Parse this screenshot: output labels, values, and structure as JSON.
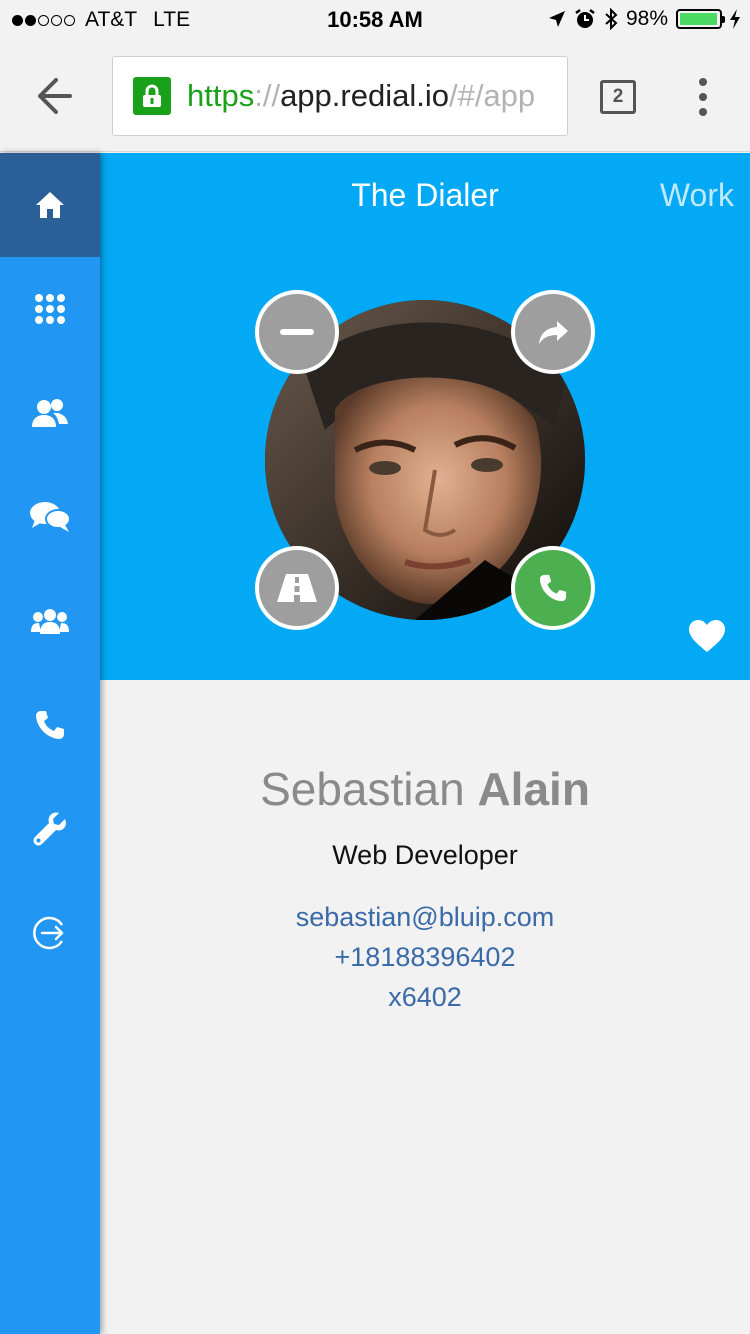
{
  "status_bar": {
    "carrier": "AT&T",
    "network": "LTE",
    "time": "10:58 AM",
    "battery": "98%",
    "battery_level": 0.98
  },
  "browser": {
    "url_protocol": "https",
    "url_sep": "://",
    "url_host": "app.redial.io",
    "url_path": "/#/app",
    "tab_count": "2"
  },
  "sidebar": {
    "items": [
      {
        "icon": "home-icon",
        "active": true
      },
      {
        "icon": "dialpad-icon"
      },
      {
        "icon": "contacts-icon"
      },
      {
        "icon": "chat-icon"
      },
      {
        "icon": "groups-icon"
      },
      {
        "icon": "phone-icon"
      },
      {
        "icon": "wrench-icon"
      },
      {
        "icon": "logout-icon"
      }
    ]
  },
  "header": {
    "title": "The Dialer",
    "tag": "Work"
  },
  "profile": {
    "first_name": "Sebastian",
    "last_name": "Alain",
    "job_title": "Web Developer",
    "email": "sebastian@bluip.com",
    "phone": "+18188396402",
    "extension": "x6402"
  },
  "colors": {
    "header_bg": "#03a9f4",
    "sidebar_bg": "#2196f3",
    "sidebar_active": "#2a5f98",
    "call_green": "#4caf50",
    "action_grey": "#9e9e9e"
  }
}
